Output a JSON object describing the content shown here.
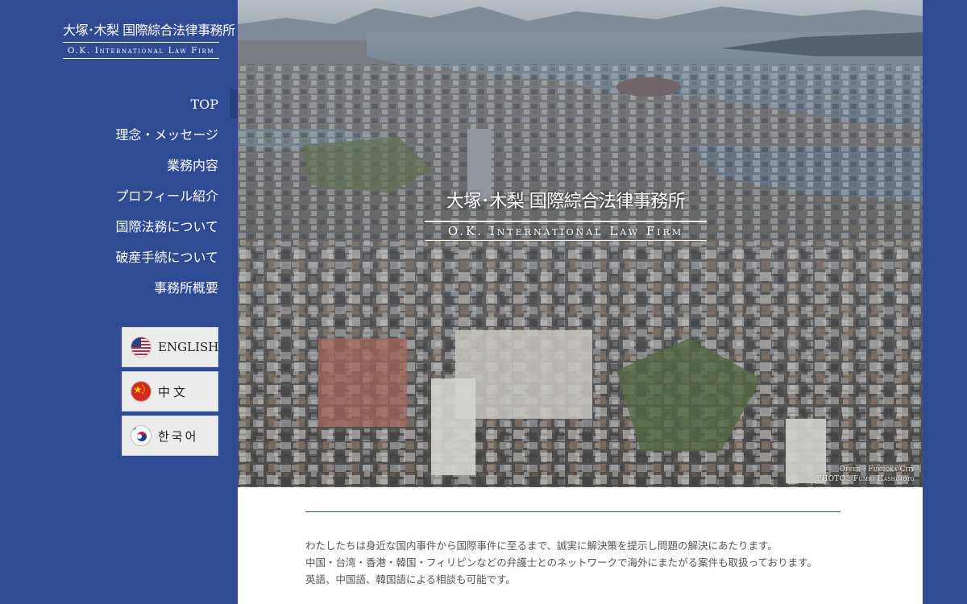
{
  "colors": {
    "brand_blue": "#2f4b93",
    "panel_white": "#ffffff",
    "body_text": "#555555"
  },
  "logo": {
    "jp": "大塚･木梨 国際綜合法律事務所",
    "en": "O.K. International Law Firm"
  },
  "nav": {
    "items": [
      {
        "label": "TOP",
        "active": true
      },
      {
        "label": "理念・メッセージ"
      },
      {
        "label": "業務内容"
      },
      {
        "label": "プロフィール紹介"
      },
      {
        "label": "国際法務について"
      },
      {
        "label": "破産手続について"
      },
      {
        "label": "事務所概要"
      }
    ]
  },
  "languages": [
    {
      "label": "ENGLISH",
      "icon": "us-flag-icon"
    },
    {
      "label": "中文",
      "icon": "china-flag-icon"
    },
    {
      "label": "한국어",
      "icon": "korea-flag-icon"
    }
  ],
  "hero": {
    "title_jp": "大塚･木梨 国際綜合法律事務所",
    "title_en": "O.K. International Law Firm",
    "credit_line1": "Offer : Fukuoka City",
    "credit_line2": "PHOTO : Fumio Hashimoto"
  },
  "intro": {
    "line1": "わたしたちは身近な国内事件から国際事件に至るまで、誠実に解決策を提示し問題の解決にあたります。",
    "line2": "中国・台湾・香港・韓国・フィリピンなどの弁護士とのネットワークで海外にまたがる案件も取扱っております。",
    "line3": "英語、中国語、韓国語による相談も可能です。"
  }
}
